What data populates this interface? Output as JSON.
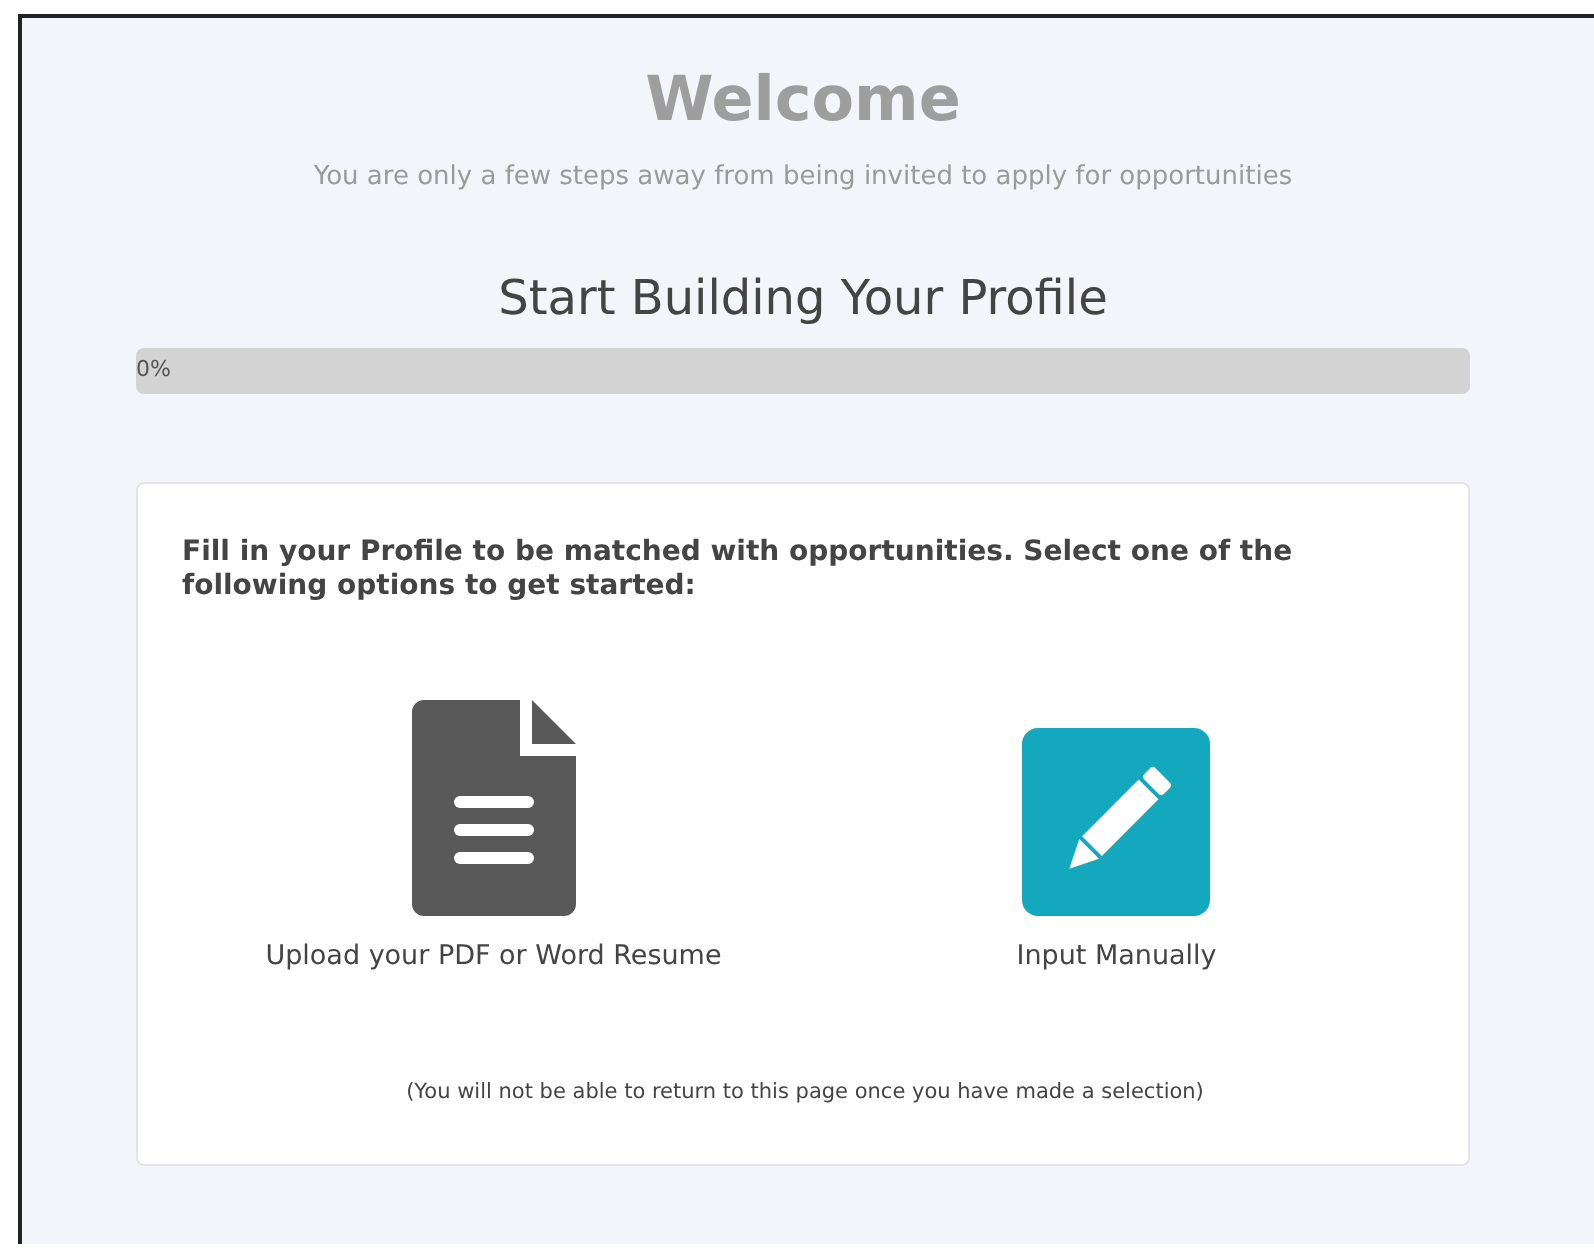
{
  "title": "Welcome",
  "subtitle": "You are only a few steps away from being invited to apply for opportunities",
  "progress": {
    "heading": "Start Building Your Profile",
    "level": 0,
    "label": "0%"
  },
  "card": {
    "instruction": "Fill in your Profile to be matched with opportunities. Select one of the following options to get started:",
    "options": [
      {
        "kind": "document",
        "label": "Upload your PDF or Word Resume"
      },
      {
        "kind": "pencil",
        "label": "Input Manually"
      }
    ],
    "note": "(You will not be able to return to this page once you have made a selection)"
  }
}
